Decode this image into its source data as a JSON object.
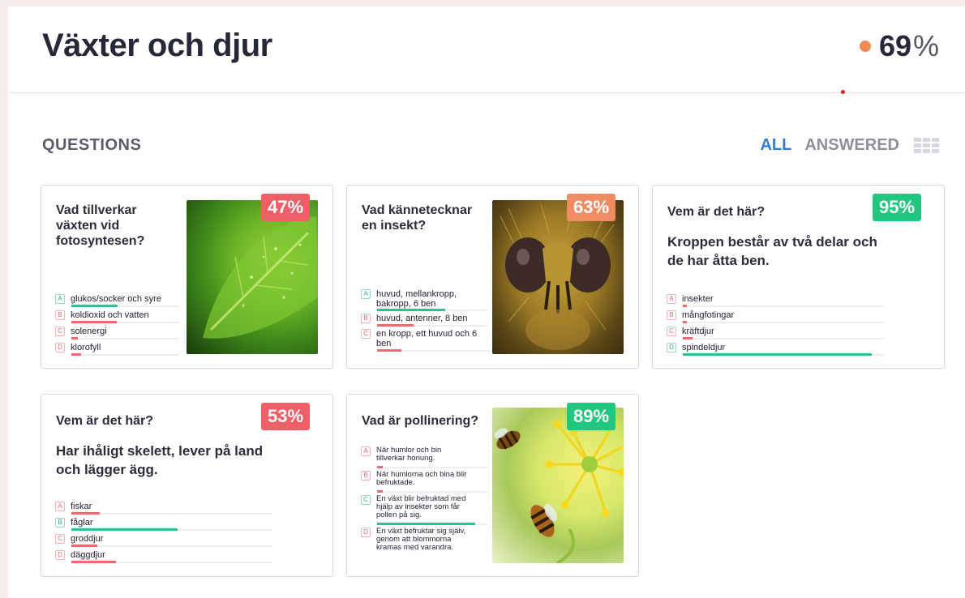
{
  "header": {
    "title": "Växter och djur",
    "score": "69",
    "score_unit": "%"
  },
  "section": {
    "title": "QUESTIONS",
    "filter_all": "ALL",
    "filter_answered": "ANSWERED"
  },
  "colors": {
    "correct": "#2fc08b",
    "wrong": "#ec6a72",
    "badge_red": "#ef5f67",
    "badge_orange": "#f08c62",
    "badge_green": "#1fc87e",
    "accent_blue": "#2f7bd8"
  },
  "cards": [
    {
      "question": "Vad tillverkar växten vid fotosyntesen?",
      "percent": "47%",
      "image": "leaf-photo",
      "answers": [
        {
          "letter": "A",
          "text": "glukos/socker och syre",
          "correct": true,
          "share": 0.43
        },
        {
          "letter": "B",
          "text": "koldioxid och vatten",
          "correct": false,
          "share": 0.42
        },
        {
          "letter": "C",
          "text": "solenergi",
          "correct": false,
          "share": 0.06
        },
        {
          "letter": "D",
          "text": "klorofyll",
          "correct": false,
          "share": 0.09
        }
      ]
    },
    {
      "question": "Vad kännetecknar en insekt?",
      "percent": "63%",
      "image": "insect-photo",
      "answers": [
        {
          "letter": "A",
          "text": "huvud, mellankropp, bakropp, 6 ben",
          "correct": true,
          "share": 0.62
        },
        {
          "letter": "B",
          "text": "huvud, antenner, 8 ben",
          "correct": false,
          "share": 0.33
        },
        {
          "letter": "C",
          "text": "en kropp, ett huvud och 6 ben",
          "correct": false,
          "share": 0.22
        }
      ]
    },
    {
      "question": "Vem är det här?",
      "subtext": "Kroppen består av två delar och de har åtta ben.",
      "percent": "95%",
      "answers": [
        {
          "letter": "A",
          "text": "insekter",
          "correct": false,
          "share": 0.02
        },
        {
          "letter": "B",
          "text": "mångfotingar",
          "correct": false,
          "share": 0.02
        },
        {
          "letter": "C",
          "text": "kräftdjur",
          "correct": false,
          "share": 0.05
        },
        {
          "letter": "D",
          "text": "spindeldjur",
          "correct": true,
          "share": 0.94
        }
      ]
    },
    {
      "question": "Vem är det här?",
      "subtext": "Har ihåligt skelett, lever på land och lägger ägg.",
      "percent": "53%",
      "answers": [
        {
          "letter": "A",
          "text": "fiskar",
          "correct": false,
          "share": 0.14
        },
        {
          "letter": "B",
          "text": "fåglar",
          "correct": true,
          "share": 0.53
        },
        {
          "letter": "C",
          "text": "groddjur",
          "correct": false,
          "share": 0.13
        },
        {
          "letter": "D",
          "text": "däggdjur",
          "correct": false,
          "share": 0.22
        }
      ]
    },
    {
      "question": "Vad är pollinering?",
      "percent": "89%",
      "image": "bee-flower-photo",
      "answers": [
        {
          "letter": "A",
          "text": "När humlor och bin tillverkar honung.",
          "correct": false,
          "share": 0.05
        },
        {
          "letter": "B",
          "text": "När humlorna och bina blir befruktade.",
          "correct": false,
          "share": 0.05
        },
        {
          "letter": "C",
          "text": "En växt blir befruktad med hjälp av insekter som får pollen på sig.",
          "correct": true,
          "share": 0.89
        },
        {
          "letter": "D",
          "text": "En växt befruktar sig själv, genom att blommorna kramas med varandra.",
          "correct": false,
          "share": 0.05
        }
      ]
    }
  ]
}
